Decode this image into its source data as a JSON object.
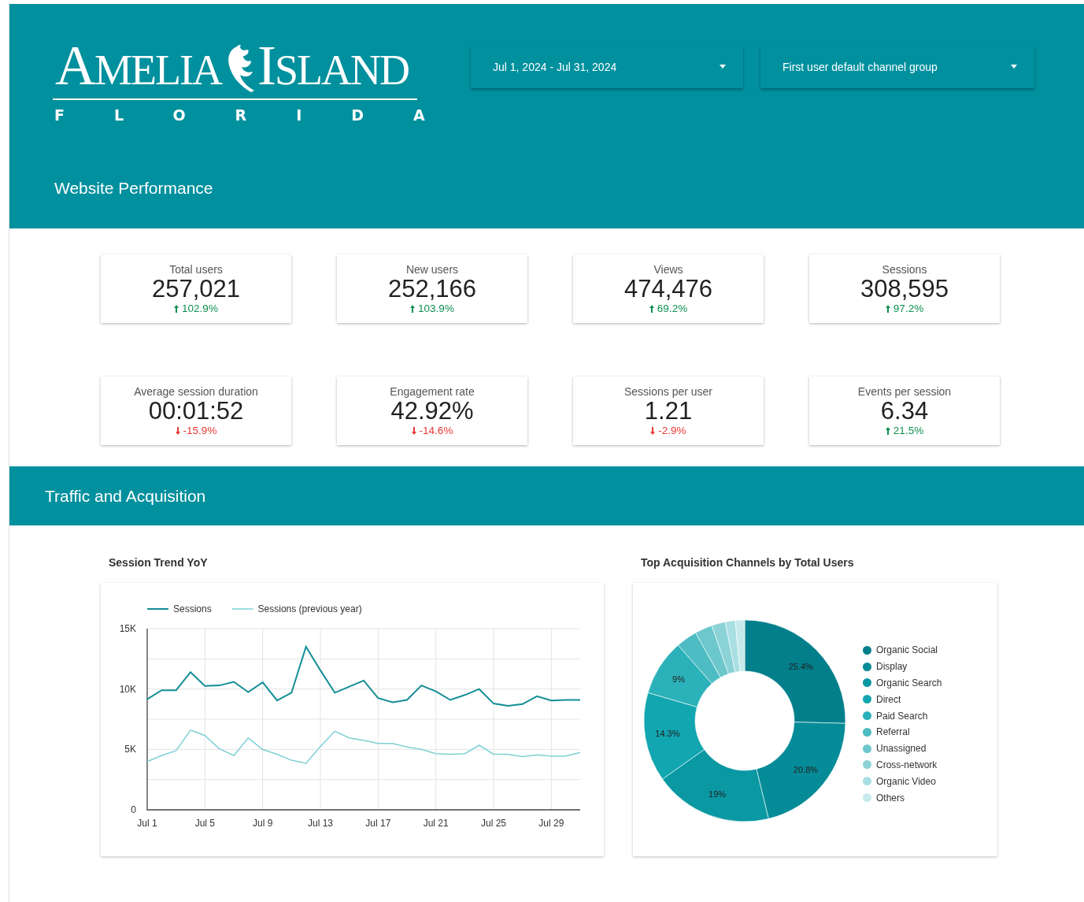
{
  "header": {
    "logo": {
      "name_left": "AMELIA",
      "name_right": "ISLAND",
      "tagline": "FLORIDA"
    },
    "filters": [
      {
        "label": "Jul 1, 2024 - Jul 31, 2024"
      },
      {
        "label": "First user default channel group"
      }
    ],
    "title": "Website Performance"
  },
  "scorecards": [
    {
      "label": "Total users",
      "value": "257,021",
      "change": "102.9%",
      "increase": true
    },
    {
      "label": "New users",
      "value": "252,166",
      "change": "103.9%",
      "increase": true
    },
    {
      "label": "Views",
      "value": "474,476",
      "change": "69.2%",
      "increase": true
    },
    {
      "label": "Sessions",
      "value": "308,595",
      "change": "97.2%",
      "increase": true
    },
    {
      "label": "Average session duration",
      "value": "00:01:52",
      "change": "-15.9%",
      "increase": false
    },
    {
      "label": "Engagement rate",
      "value": "42.92%",
      "change": "-14.6%",
      "increase": false
    },
    {
      "label": "Sessions per user",
      "value": "1.21",
      "change": "-2.9%",
      "increase": false
    },
    {
      "label": "Events per session",
      "value": "6.34",
      "change": "21.5%",
      "increase": true
    }
  ],
  "traffic_section": {
    "title": "Traffic and Acquisition",
    "session_trend": {
      "chart_data": {
        "type": "line",
        "title": "Session Trend YoY",
        "categories": [
          "Jul 1",
          null,
          null,
          null,
          "Jul 5",
          null,
          null,
          null,
          "Jul 9",
          null,
          null,
          null,
          "Jul 13",
          null,
          null,
          null,
          "Jul 17",
          null,
          null,
          null,
          "Jul 21",
          null,
          null,
          null,
          "Jul 25",
          null,
          null,
          null,
          "Jul 29",
          null,
          null
        ],
        "legend": true,
        "grid": true,
        "series": [
          {
            "name": "Sessions",
            "color": "#138d96",
            "values": [
              9150,
              9900,
              9900,
              11400,
              10250,
              10300,
              10600,
              9750,
              10550,
              9050,
              9700,
              13500,
              11550,
              9700,
              10200,
              10700,
              9250,
              8900,
              9100,
              10300,
              9800,
              9100,
              9500,
              10000,
              8800,
              8600,
              8750,
              9400,
              9050,
              9100,
              9100
            ]
          },
          {
            "name": "Sessions (previous year)",
            "color": "#7fd0d4",
            "values": [
              4000,
              4500,
              4900,
              6600,
              6150,
              5050,
              4500,
              5950,
              5000,
              4600,
              4100,
              3850,
              5250,
              6500,
              5950,
              5750,
              5500,
              5500,
              5200,
              5000,
              4650,
              4600,
              4650,
              5350,
              4600,
              4600,
              4400,
              4550,
              4450,
              4450,
              4750
            ]
          }
        ],
        "ylim": [
          0,
          15000
        ],
        "yticks": [
          0,
          {
            "value": 5000,
            "label": "5K"
          },
          {
            "value": 10000,
            "label": "10K"
          },
          {
            "value": 15000,
            "label": "15K"
          }
        ]
      }
    },
    "acquisition_channels": {
      "chart_data": {
        "type": "donut",
        "title": "Top Acquisition Channels by Total Users",
        "categories": [
          "Organic Social",
          "Display",
          "Organic Search",
          "Direct",
          "Paid Search",
          "Referral",
          "Unassigned",
          "Cross-network",
          "Organic Video",
          "Others"
        ],
        "values": [
          25.4,
          20.8,
          19,
          14.3,
          9,
          3.4,
          2.8,
          2.2,
          1.6,
          1.5
        ],
        "value_labels": [
          "25.4%",
          "20.8%",
          "19%",
          "14.3%",
          "9%",
          null,
          null,
          null,
          null,
          null
        ],
        "legend": true
      },
      "slices": [
        {
          "color": "#037f8c"
        },
        {
          "color": "#068c98"
        },
        {
          "color": "#0a98a3"
        },
        {
          "color": "#11a6b0"
        },
        {
          "color": "#2bb1b9"
        },
        {
          "color": "#4dbcc3"
        },
        {
          "color": "#6cc8cd"
        },
        {
          "color": "#8bd3d7"
        },
        {
          "color": "#a9dfe2"
        },
        {
          "color": "#c6eaec"
        }
      ]
    }
  }
}
